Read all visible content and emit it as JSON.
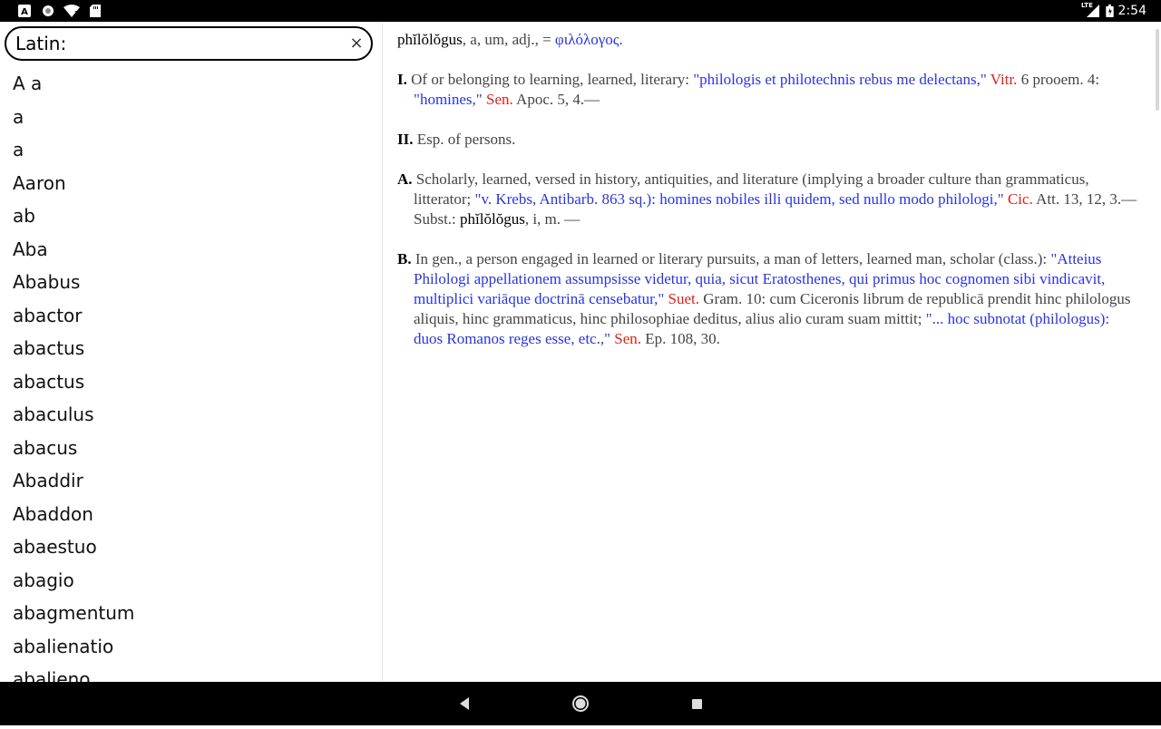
{
  "status_bar": {
    "time": "2:54",
    "network_label": "LTE",
    "icons": [
      "app-a-icon",
      "circle-app-icon",
      "wifi-icon",
      "sd-card-icon",
      "signal-icon",
      "battery-icon"
    ]
  },
  "search": {
    "value": "Latin:",
    "clear_label": "×"
  },
  "word_list": [
    "A a",
    "a",
    "a",
    "Aaron",
    "ab",
    "Aba",
    "Ababus",
    "abactor",
    "abactus",
    "abactus",
    "abaculus",
    "abacus",
    "Abaddir",
    "Abaddon",
    "abaestuo",
    "abagio",
    "abagmentum",
    "abalienatio",
    "abalieno"
  ],
  "entry": {
    "headline": {
      "headword": "phĭlŏlŏgus",
      "grammar": ", a, um, adj., = ",
      "greek": "φιλόλογος."
    },
    "sense_1": {
      "num": "I.",
      "t1": " Of or belonging to learning, learned, literary: ",
      "q1": "\"philologis et philotechnis rebus me delectans,\"",
      "a1": " Vitr.",
      "t2": " 6 prooem. 4: ",
      "q2": "\"homines,\"",
      "a2": " Sen.",
      "t3": " Apoc. 5, 4.—"
    },
    "sense_2": {
      "num": "II.",
      "t1": " Esp. of persons."
    },
    "sense_a": {
      "num": "A.",
      "t1": " Scholarly, learned, versed in history, antiquities, and literature (implying a broader culture than grammaticus, litterator; ",
      "q1": "\"v. Krebs, Antibarb. 863 sq.): homines nobiles illi quidem, sed nullo modo philologi,\"",
      "a1": " Cic.",
      "t2": " Att. 13, 12, 3.—Subst.: ",
      "hw": "phĭlŏlŏgus",
      "t3": ", i, m. —"
    },
    "sense_b": {
      "num": "B.",
      "t1": " In gen., a person engaged in learned or literary pursuits, a man of letters, learned man, scholar (class.): ",
      "q1": "\"Atteius Philologi appellationem assumpsisse videtur, quia, sicut Eratosthenes, qui primus hoc cognomen sibi vindicavit, multiplici variāque doctrinā censebatur,\"",
      "a1": " Suet.",
      "t2": " Gram. 10: cum Ciceronis librum de republicā prendit hinc philologus aliquis, hinc grammaticus, hinc philosophiae deditus, alius alio curam suam mittit; ",
      "q2": "\"... hoc subnotat (philologus): duos Romanos reges esse, etc.,\"",
      "a2": " Sen.",
      "t3": " Ep. 108, 30."
    }
  },
  "colors": {
    "quote": "#2a36d6",
    "author": "#e0201a",
    "body_text": "#444444",
    "bars": "#000000"
  },
  "nav_bar": {
    "buttons": [
      "back-icon",
      "home-icon",
      "recents-icon"
    ]
  }
}
